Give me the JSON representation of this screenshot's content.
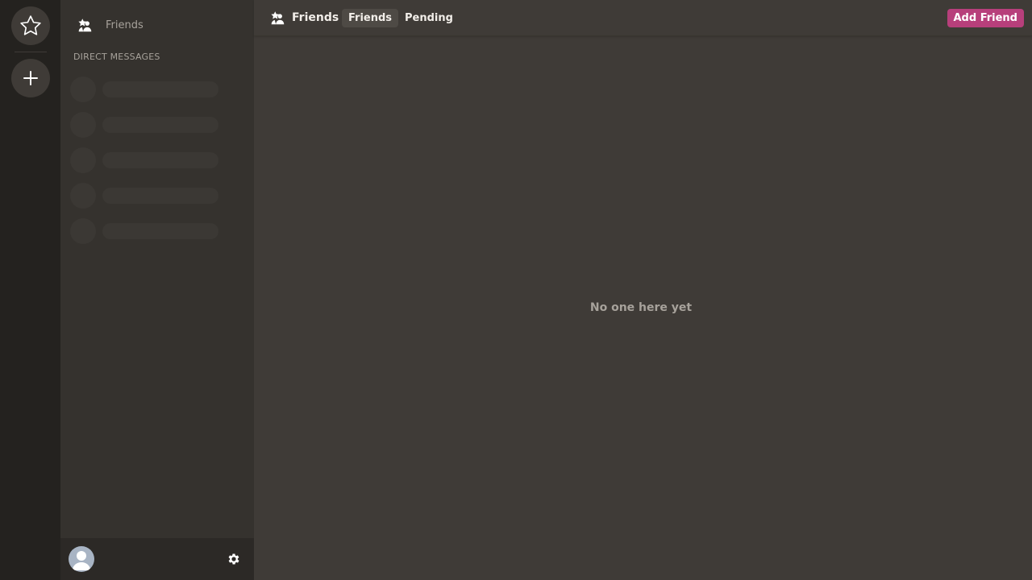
{
  "rail": {
    "home_icon": "star-icon",
    "add_icon": "plus-icon"
  },
  "sidebar": {
    "friends_label": "Friends",
    "friends_icon": "friends-icon",
    "dm_header": "DIRECT MESSAGES",
    "dm_placeholder_count_visible": 5
  },
  "user_panel": {
    "avatar_icon": "user-avatar-icon",
    "settings_icon": "gear-icon"
  },
  "topbar": {
    "title": "Friends",
    "tabs": [
      {
        "label": "Friends",
        "active": true
      },
      {
        "label": "Pending",
        "active": false
      }
    ],
    "add_friend_label": "Add Friend"
  },
  "main": {
    "empty_message": "No one here yet"
  },
  "colors": {
    "accent": "#b73f7b",
    "background": "#3f3b37",
    "sidebar": "#35322e",
    "rail": "#24221f"
  }
}
